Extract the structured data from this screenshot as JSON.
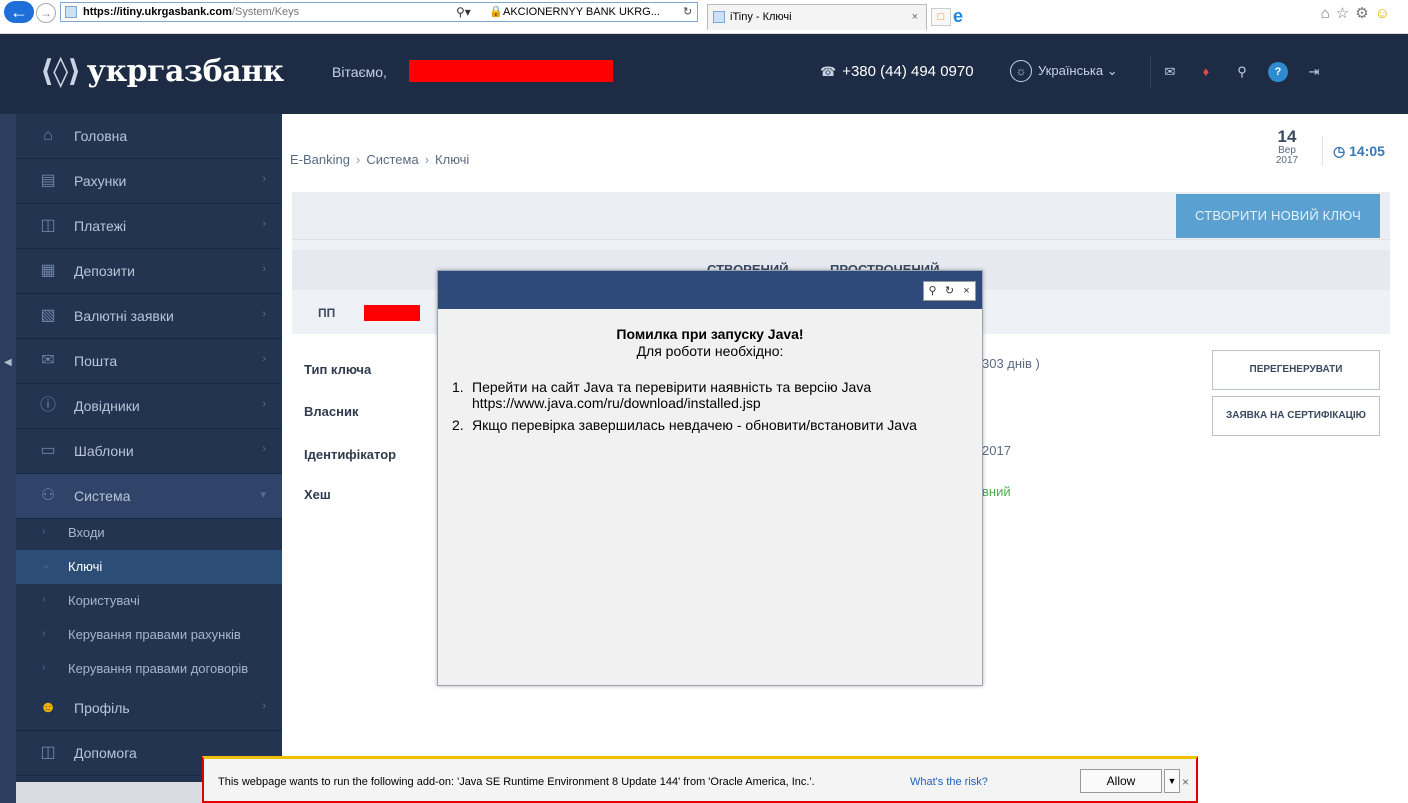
{
  "browser": {
    "url_host": "https://itiny.ukrgasbank.com",
    "url_path": "/System/Keys",
    "cert_label": "AKCIONERNYY BANK UKRG...",
    "tab_title": "iTiny - Ключі"
  },
  "header": {
    "logo_text": "укргазбанк",
    "greeting": "Вітаємо,",
    "phone": "+380 (44) 494 0970",
    "language": "Українська"
  },
  "sidebar": {
    "items": [
      {
        "label": "Головна",
        "icon": "home-icon"
      },
      {
        "label": "Рахунки",
        "icon": "accounts-icon"
      },
      {
        "label": "Платежі",
        "icon": "payments-icon"
      },
      {
        "label": "Депозити",
        "icon": "deposits-icon"
      },
      {
        "label": "Валютні заявки",
        "icon": "currency-icon"
      },
      {
        "label": "Пошта",
        "icon": "mail-icon"
      },
      {
        "label": "Довідники",
        "icon": "info-icon"
      },
      {
        "label": "Шаблони",
        "icon": "templates-icon"
      },
      {
        "label": "Система",
        "icon": "system-icon"
      }
    ],
    "subitems": [
      {
        "label": "Входи"
      },
      {
        "label": "Ключі"
      },
      {
        "label": "Користувачі"
      },
      {
        "label": "Керування правами рахунків"
      },
      {
        "label": "Керування правами договорів"
      }
    ],
    "bottom": [
      {
        "label": "Профіль",
        "icon": "profile-icon"
      },
      {
        "label": "Допомога",
        "icon": "help-icon"
      }
    ]
  },
  "main": {
    "breadcrumb": [
      "E-Banking",
      "Система",
      "Ключі"
    ],
    "date": {
      "day": "14",
      "month": "Вер",
      "year": "2017"
    },
    "time": "14:05",
    "create_button": "СТВОРИТИ НОВИЙ КЛЮЧ",
    "tabs": [
      "СТВОРЕНИЙ",
      "ПРОСТРОЧЕНИЙ"
    ],
    "filter_prefix": "ПП",
    "details": {
      "labels": [
        "Тип ключа",
        "Власник",
        "Ідентифікатор",
        "Хеш"
      ],
      "values": [
        "303 днів )",
        "2017",
        "вний"
      ]
    },
    "actions": [
      "ПЕРЕГЕНЕРУВАТИ",
      "ЗАЯВКА НА СЕРТИФІКАЦІЮ"
    ]
  },
  "modal": {
    "title": "Помилка при запуску Java!",
    "subtitle": "Для роботи необхідно:",
    "steps": [
      {
        "num": "1.",
        "text": "Перейти на сайт Java та перевірити наявність та версію Java https://www.java.com/ru/download/installed.jsp"
      },
      {
        "num": "2.",
        "text": "Якщо перевірка завершилась невдачею - обновити/встановити Java"
      }
    ]
  },
  "notification": {
    "message": "This webpage wants to run the following add-on: 'Java SE Runtime Environment 8 Update 144' from 'Oracle America, Inc.'.",
    "risk_link": "What's the risk?",
    "allow_label": "Allow"
  },
  "colors": {
    "header_bg": "#1d2b45",
    "sidebar_bg": "#233451",
    "accent_button": "#5aa0d0",
    "modal_bar": "#2e4a7a",
    "redaction": "#ff0000"
  }
}
